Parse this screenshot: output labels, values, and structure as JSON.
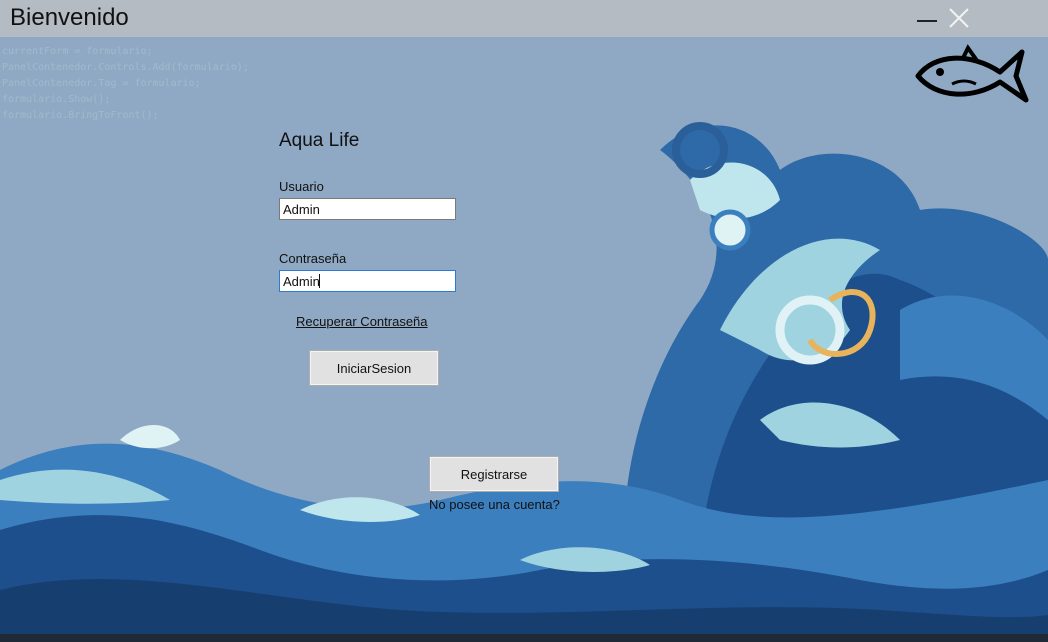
{
  "window": {
    "title": "Bienvenido",
    "minimize_icon": "minimize-icon",
    "close_icon": "close-icon"
  },
  "logo": {
    "icon": "fish-icon"
  },
  "form": {
    "app_name": "Aqua Life",
    "user_label": "Usuario",
    "user_value": "Admin",
    "password_label": "Contraseña",
    "password_value": "Admin",
    "recover_link": "Recuperar Contraseña",
    "login_button": "IniciarSesion",
    "register_button": "Registrarse",
    "no_account_text": "No posee una cuenta?"
  },
  "colors": {
    "background": "#8fa9c4",
    "titlebar": "#b9bdc2",
    "wave_dark": "#1d4f8c",
    "wave_mid": "#3b7fbf",
    "wave_light": "#9fd3e0"
  }
}
